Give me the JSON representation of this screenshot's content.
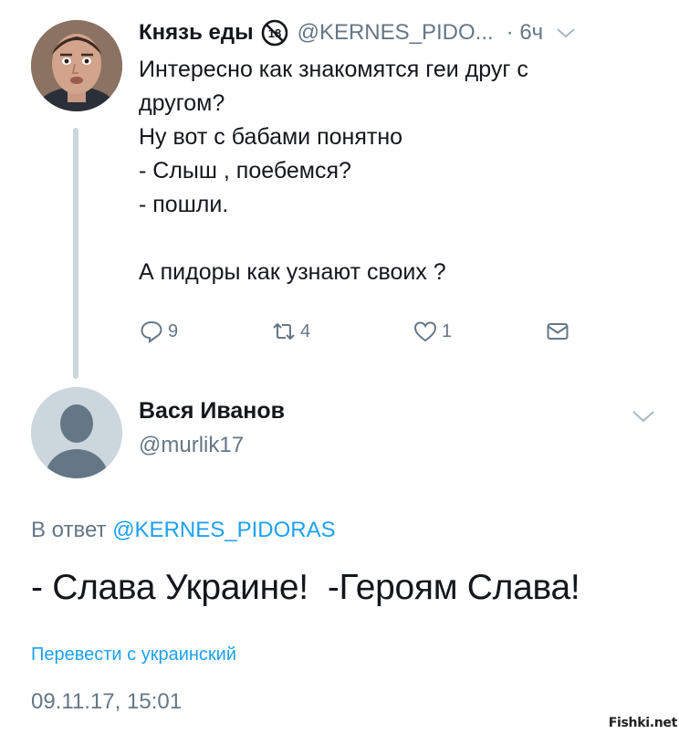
{
  "tweet": {
    "author_name": "Князь еды",
    "handle": "@KERNES_PIDO...",
    "time": "· 6ч",
    "lines": [
      "Интересно как знакомятся геи друг с",
      "другом?",
      "Ну вот с бабами понятно",
      "- Слыш , поебемся?",
      "- пошли.",
      "",
      "А пидоры как узнают своих ?"
    ],
    "age_badge": "18",
    "reply_count": "9",
    "retweet_count": "4",
    "like_count": "1"
  },
  "reply": {
    "author_name": "Вася Иванов",
    "handle": "@murlik17",
    "reply_to_prefix": "В ответ",
    "reply_to_mention": "@KERNES_PIDORAS",
    "text": "- Слава Украине!  -Героям Слава!",
    "translate_link": "Перевести с украинский",
    "timestamp": "09.11.17, 15:01"
  },
  "watermark": "Fishki.net",
  "icons": {
    "reply": "reply-icon",
    "retweet": "retweet-icon",
    "like": "heart-icon",
    "message": "envelope-icon",
    "menu": "chevron-down-icon",
    "age": "age-18-badge-icon"
  },
  "colors": {
    "text": "#14171a",
    "secondary": "#657786",
    "link": "#1da1f2",
    "divider": "#ccd6dd"
  }
}
